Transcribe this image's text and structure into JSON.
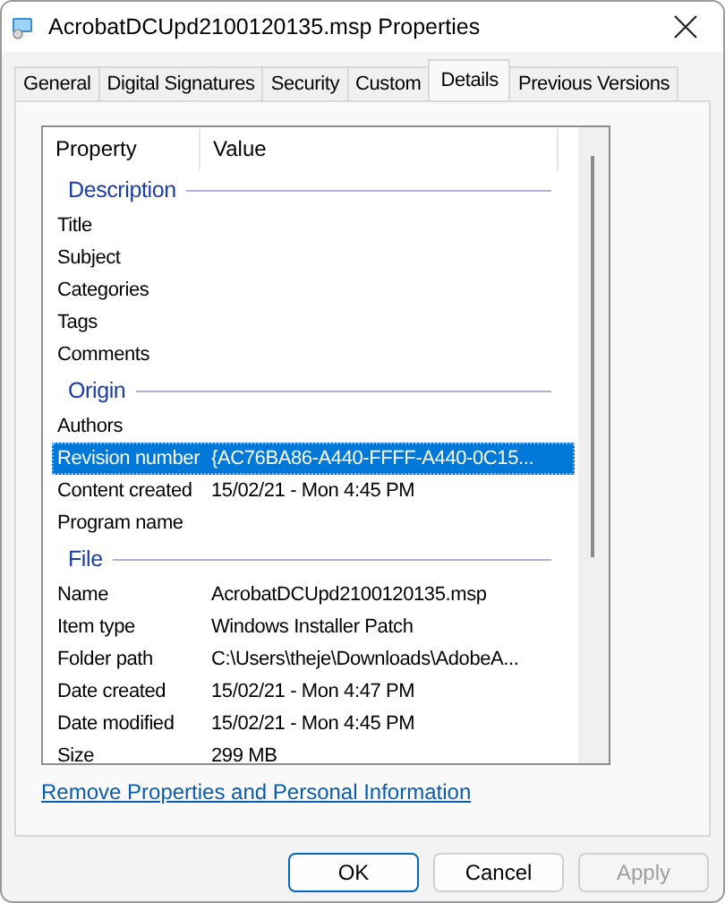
{
  "window": {
    "title": "AcrobatDCUpd2100120135.msp Properties"
  },
  "tabs": [
    {
      "label": "General",
      "selected": false
    },
    {
      "label": "Digital Signatures",
      "selected": false
    },
    {
      "label": "Security",
      "selected": false
    },
    {
      "label": "Custom",
      "selected": false
    },
    {
      "label": "Details",
      "selected": true
    },
    {
      "label": "Previous Versions",
      "selected": false
    }
  ],
  "columns": [
    "Property",
    "Value"
  ],
  "groups": [
    {
      "title": "Description",
      "rows": [
        {
          "property": "Title",
          "value": "",
          "selected": false
        },
        {
          "property": "Subject",
          "value": "",
          "selected": false
        },
        {
          "property": "Categories",
          "value": "",
          "selected": false
        },
        {
          "property": "Tags",
          "value": "",
          "selected": false
        },
        {
          "property": "Comments",
          "value": "",
          "selected": false
        }
      ]
    },
    {
      "title": "Origin",
      "rows": [
        {
          "property": "Authors",
          "value": "",
          "selected": false
        },
        {
          "property": "Revision number",
          "value": "{AC76BA86-A440-FFFF-A440-0C15...",
          "selected": true
        },
        {
          "property": "Content created",
          "value": "15/02/21 - Mon 4:45 PM",
          "selected": false
        },
        {
          "property": "Program name",
          "value": "",
          "selected": false
        }
      ]
    },
    {
      "title": "File",
      "rows": [
        {
          "property": "Name",
          "value": "AcrobatDCUpd2100120135.msp",
          "selected": false
        },
        {
          "property": "Item type",
          "value": "Windows Installer Patch",
          "selected": false
        },
        {
          "property": "Folder path",
          "value": "C:\\Users\\theje\\Downloads\\AdobeA...",
          "selected": false
        },
        {
          "property": "Date created",
          "value": "15/02/21 - Mon 4:47 PM",
          "selected": false
        },
        {
          "property": "Date modified",
          "value": "15/02/21 - Mon 4:45 PM",
          "selected": false
        },
        {
          "property": "Size",
          "value": "299 MB",
          "selected": false
        }
      ]
    }
  ],
  "link": "Remove Properties and Personal Information",
  "buttons": [
    {
      "label": "OK",
      "kind": "default",
      "disabled": false
    },
    {
      "label": "Cancel",
      "kind": "normal",
      "disabled": false
    },
    {
      "label": "Apply",
      "kind": "normal",
      "disabled": true
    }
  ]
}
